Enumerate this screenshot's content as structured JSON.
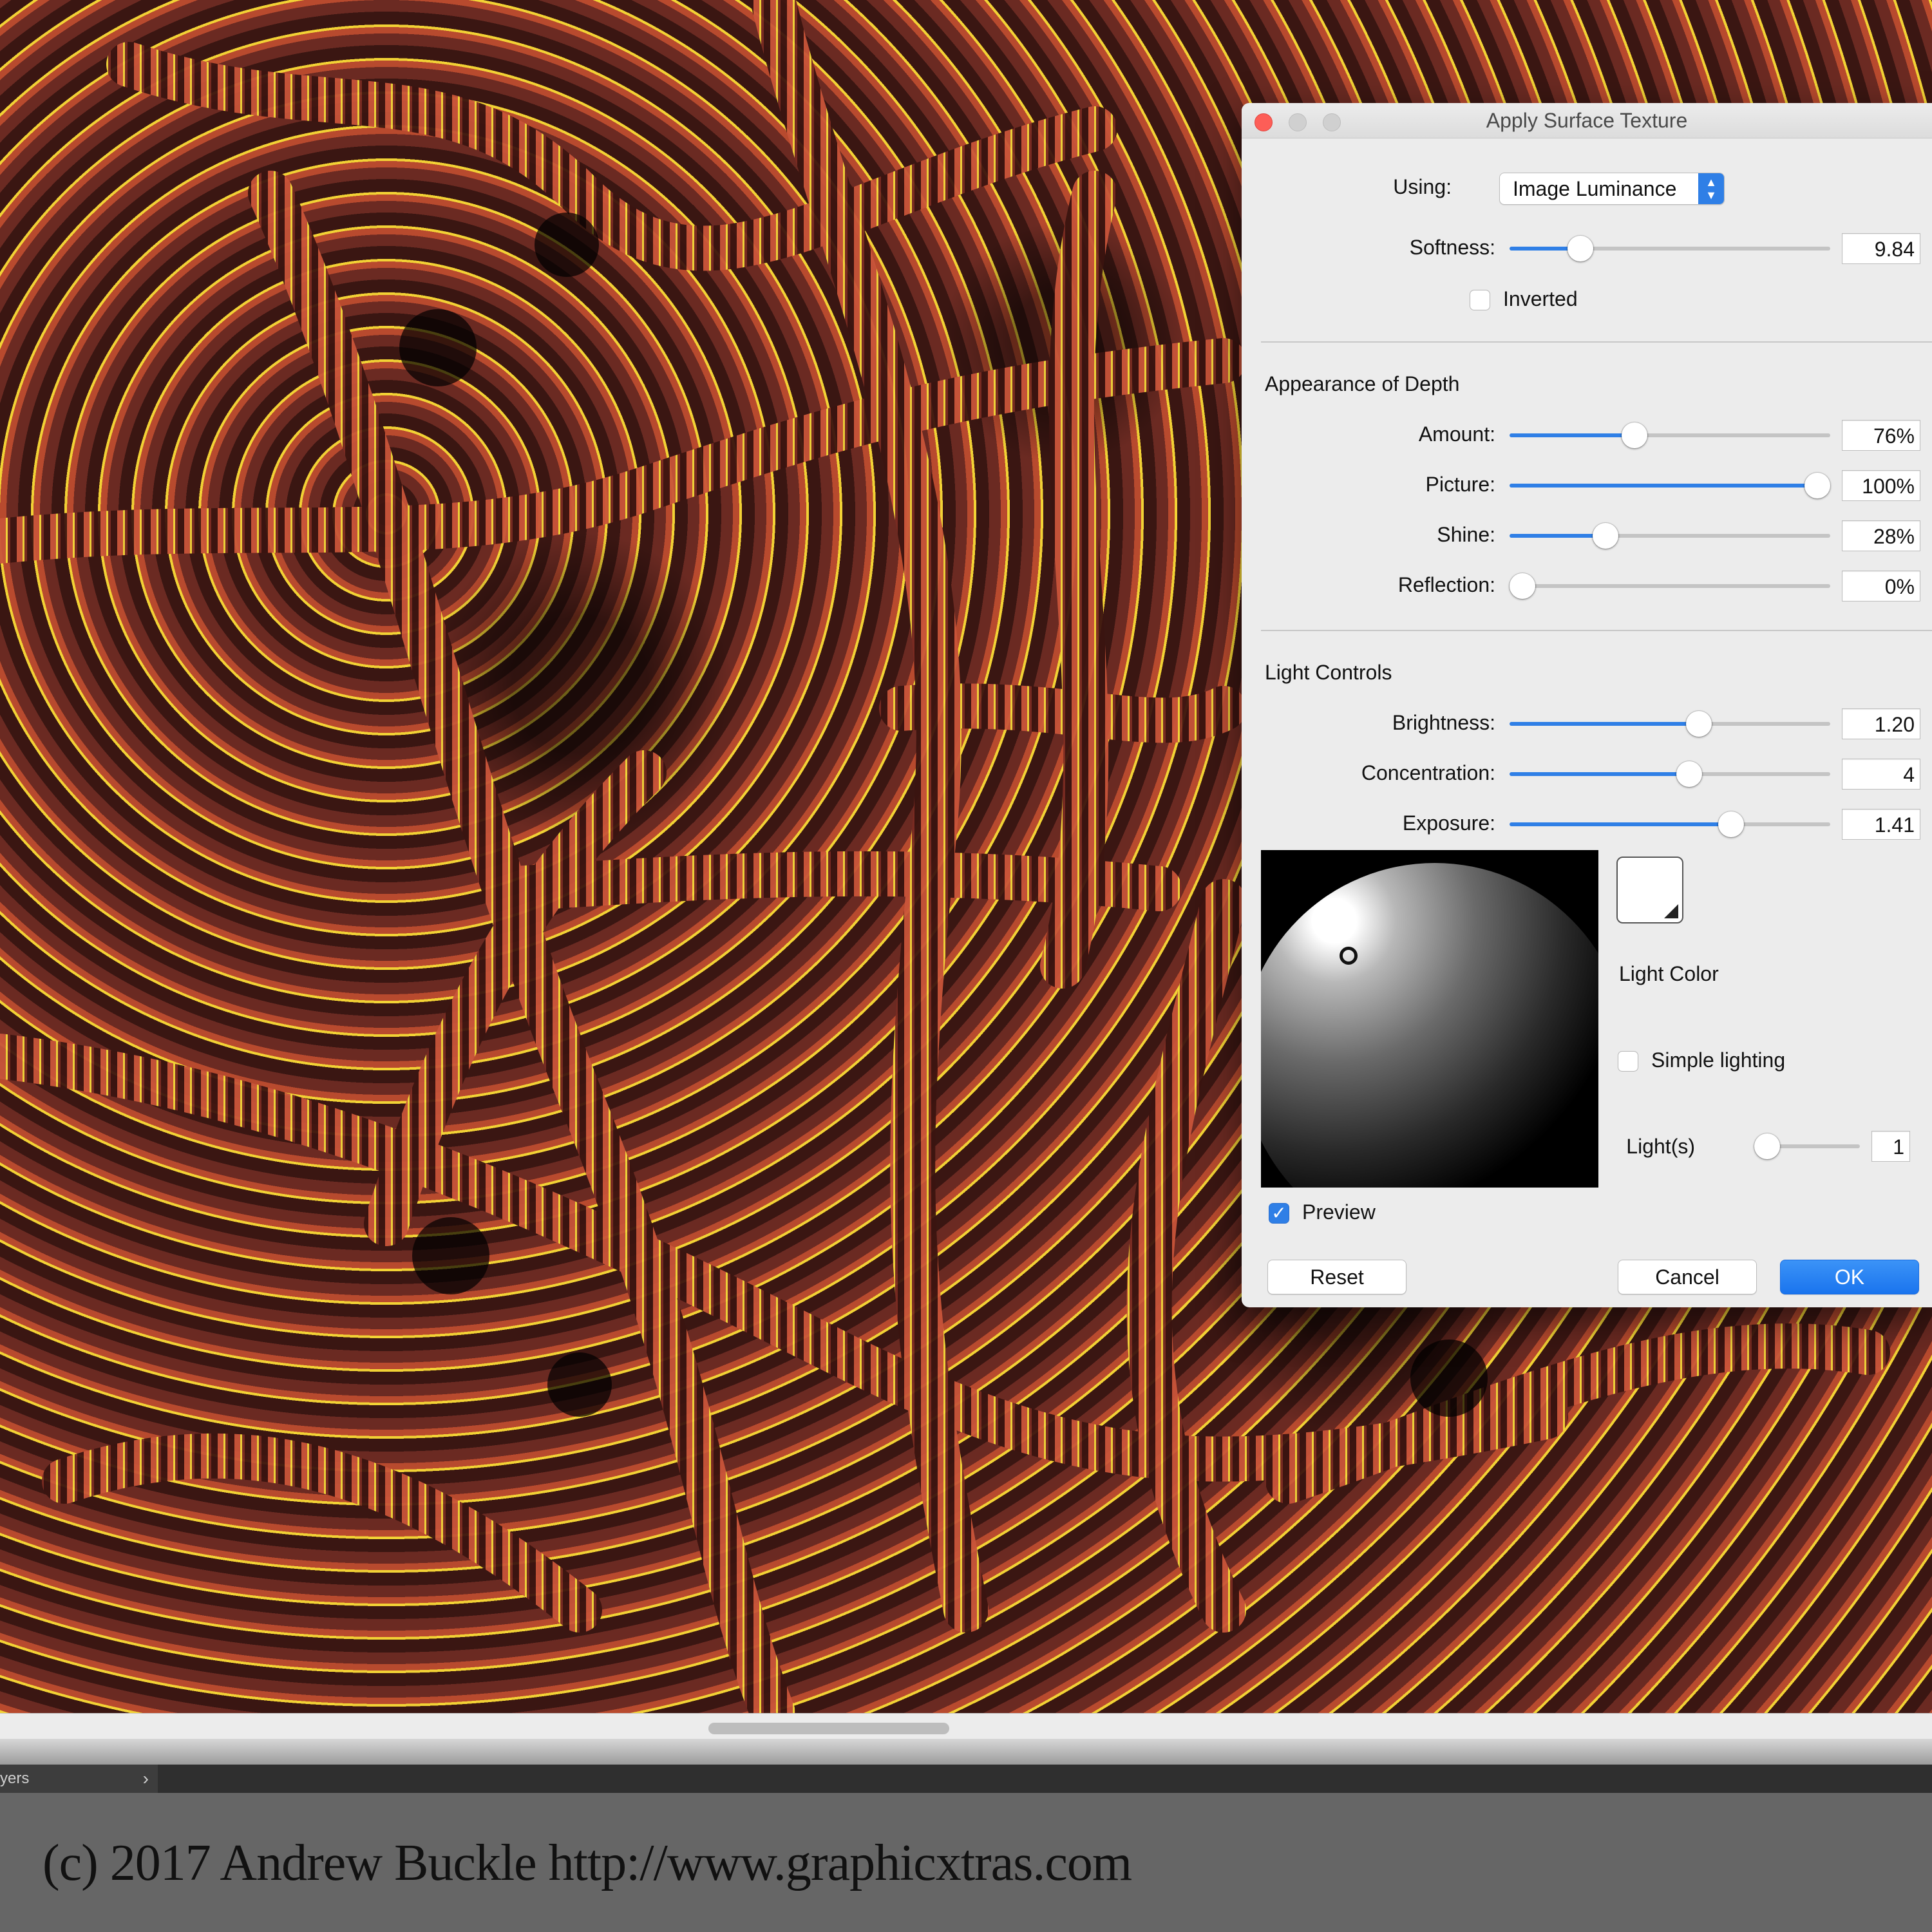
{
  "dialog": {
    "title": "Apply Surface Texture",
    "using": {
      "label": "Using:",
      "value": "Image Luminance"
    },
    "softness": {
      "label": "Softness:",
      "value": "9.84",
      "fraction": 0.22
    },
    "inverted": {
      "label": "Inverted",
      "checked": false
    },
    "depth": {
      "heading": "Appearance of Depth",
      "amount": {
        "label": "Amount:",
        "value": "76%",
        "fraction": 0.39
      },
      "picture": {
        "label": "Picture:",
        "value": "100%",
        "fraction": 0.96
      },
      "shine": {
        "label": "Shine:",
        "value": "28%",
        "fraction": 0.3
      },
      "reflection": {
        "label": "Reflection:",
        "value": "0%",
        "fraction": 0.04
      }
    },
    "light": {
      "heading": "Light Controls",
      "brightness": {
        "label": "Brightness:",
        "value": "1.20",
        "fraction": 0.59
      },
      "concentration": {
        "label": "Concentration:",
        "value": "4",
        "fraction": 0.56
      },
      "exposure": {
        "label": "Exposure:",
        "value": "1.41",
        "fraction": 0.69
      },
      "color_label": "Light Color",
      "color": "#ffffff",
      "simple_lighting": {
        "label": "Simple lighting",
        "checked": false
      },
      "lights": {
        "label": "Light(s)",
        "value": "1",
        "fraction": 0.0
      }
    },
    "preview": {
      "label": "Preview",
      "checked": true
    },
    "buttons": {
      "reset": "Reset",
      "cancel": "Cancel",
      "ok": "OK"
    }
  },
  "bottom": {
    "layers_tab": "yers",
    "credit": "(c) 2017 Andrew Buckle http://www.graphicxtras.com"
  },
  "colors": {
    "accent": "#2f7fe6",
    "close": "#fd5e57"
  }
}
